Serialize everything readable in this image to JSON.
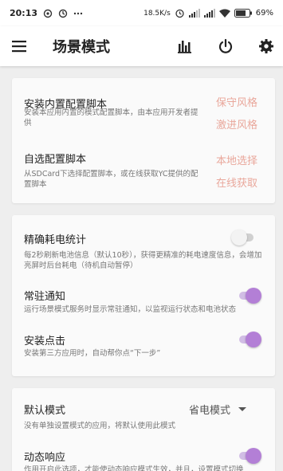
{
  "status_bar": {
    "time": "20:13",
    "net_speed": "18.5K/s",
    "battery": "69%",
    "icons": [
      "sync-icon",
      "at-icon",
      "more-icon",
      "alarm-icon",
      "signal-icon",
      "signal-icon",
      "wifi-icon",
      "battery-icon"
    ]
  },
  "app_bar": {
    "title": "场景模式",
    "icons": [
      "menu-icon",
      "chart-icon",
      "power-icon",
      "gear-icon"
    ]
  },
  "install_card": {
    "builtin": {
      "title": "安装内置配置脚本",
      "desc": "安装本应用内置的模式配置脚本，由本应用开发者提供",
      "link1": "保守风格",
      "link2": "激进风格"
    },
    "custom": {
      "title": "自选配置脚本",
      "desc": "从SDCard下选择配置脚本，或在线获取YC提供的配置脚本",
      "link1": "本地选择",
      "link2": "在线获取"
    }
  },
  "settings_card": {
    "power_stats": {
      "title": "精确耗电统计",
      "desc": "每2秒刷新电池信息（默认10秒），获得更精准的耗电速度信息，会增加亮屏时后台耗电（待机自动暂停）",
      "enabled": false
    },
    "notification": {
      "title": "常驻通知",
      "desc": "运行场景模式服务时显示常驻通知，以监视运行状态和电池状态",
      "enabled": true
    },
    "install_click": {
      "title": "安装点击",
      "desc": "安装第三方应用时，自动帮你点“下一步”",
      "enabled": true
    }
  },
  "mode_card": {
    "default_mode": {
      "title": "默认模式",
      "desc": "没有单独设置模式的应用，将默认使用此模式",
      "value": "省电模式"
    },
    "dynamic": {
      "title": "动态响应",
      "desc": "作用开启此选项，才能使动态响应模式生效，并且，设置模式切换",
      "enabled": true
    }
  },
  "colors": {
    "accent": "#b37fd6",
    "link": "#e9a79b",
    "background": "#eeeeee"
  }
}
